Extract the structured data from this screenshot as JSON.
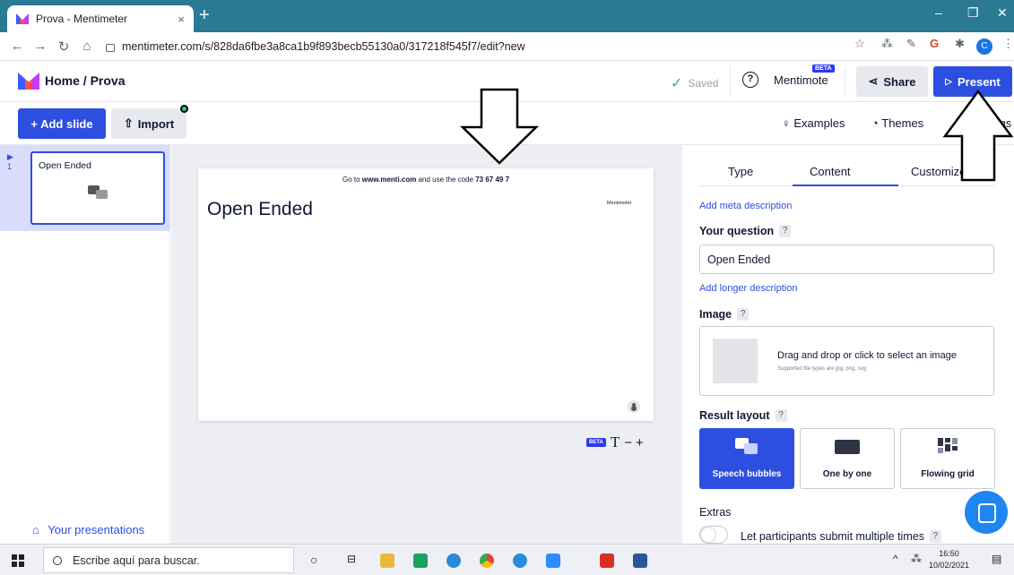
{
  "browser": {
    "tab_title": "Prova - Mentimeter",
    "tab_close": "×",
    "new_tab": "+",
    "url": "mentimeter.com/s/828da6fbe3a8ca1b9f893becb55130a0/317218f545f7/edit?new",
    "profile_initial": "C"
  },
  "header": {
    "breadcrumb": "Home / Prova",
    "saved_label": "Saved",
    "mentimote_label": "Mentimote",
    "beta_badge": "BETA",
    "share_label": "Share",
    "present_label": "Present"
  },
  "toolbar": {
    "add_slide_label": "+ Add slide",
    "import_label": "Import",
    "examples_label": "Examples",
    "themes_label": "Themes",
    "settings_label": "Settings"
  },
  "slides_panel": {
    "slides": [
      {
        "number": "1",
        "title": "Open Ended"
      }
    ],
    "your_presentations_label": "Your presentations"
  },
  "canvas": {
    "instructions_prefix": "Go to ",
    "instructions_url": "www.menti.com",
    "instructions_middle": " and use the code ",
    "instructions_code": "73 67 49 7",
    "brand_label": "Mentimeter",
    "slide_title": "Open Ended",
    "beta_label": "BETA",
    "text_glyph": "T",
    "minus": "−",
    "plus": "+"
  },
  "right_panel": {
    "tabs": [
      "Type",
      "Content",
      "Customize"
    ],
    "active_tab": "Content",
    "add_meta_description": "Add meta description",
    "your_question_label": "Your question",
    "question_value": "Open Ended",
    "add_longer_description": "Add longer description",
    "image_label": "Image",
    "image_drop_text": "Drag and drop or click to select an image",
    "image_drop_sub": "Supported file types are jpg, png, svg",
    "result_layout_label": "Result layout",
    "layouts": [
      {
        "label": "Speech bubbles",
        "active": true
      },
      {
        "label": "One by one",
        "active": false
      },
      {
        "label": "Flowing grid",
        "active": false
      }
    ],
    "extras_label": "Extras",
    "multiple_submit_label": "Let participants submit multiple times",
    "help_mark": "?"
  },
  "taskbar": {
    "search_placeholder": "Escribe aquí para buscar.",
    "time": "16:50",
    "date": "10/02/2021"
  },
  "colors": {
    "accent": "#2d4fe0",
    "tab_strip": "#2b7a93",
    "saved_check": "#2db26f"
  }
}
